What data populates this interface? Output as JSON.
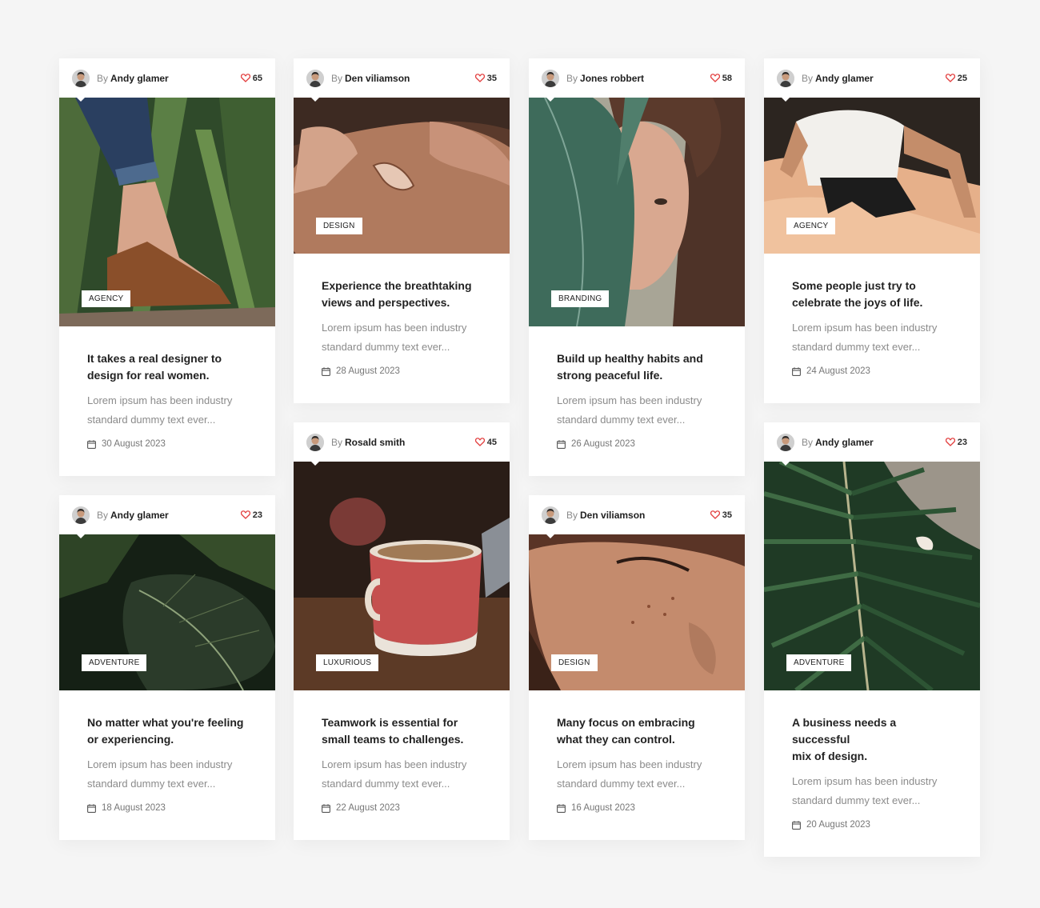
{
  "by_label": "By",
  "colors": {
    "accent_heart": "#e23d3d",
    "background": "#f5f5f5",
    "card": "#ffffff"
  },
  "posts": [
    {
      "author": "Andy glamer",
      "likes": "65",
      "tag": "AGENCY",
      "title_1": "It takes a real designer to",
      "title_2": "design for real women.",
      "excerpt_1": "Lorem ipsum has been industry",
      "excerpt_2": "standard dummy text ever...",
      "date": "30 August 2023",
      "image": "sandal-foot-in-grass"
    },
    {
      "author": "Andy glamer",
      "likes": "23",
      "tag": "ADVENTURE",
      "title_1": "No matter what you're feeling",
      "title_2": "or experiencing.",
      "excerpt_1": "Lorem ipsum has been industry",
      "excerpt_2": "standard dummy text ever...",
      "date": "18 August 2023",
      "image": "dark-green-leaf"
    },
    {
      "author": "Den viliamson",
      "likes": "35",
      "tag": "DESIGN",
      "title_1": "Experience the breathtaking",
      "title_2": "views and perspectives.",
      "excerpt_1": "Lorem ipsum has been industry",
      "excerpt_2": "standard dummy text ever...",
      "date": "28 August 2023",
      "image": "hands-on-clay"
    },
    {
      "author": "Rosald smith",
      "likes": "45",
      "tag": "LUXURIOUS",
      "title_1": "Teamwork is essential for",
      "title_2": "small teams to challenges.",
      "excerpt_1": "Lorem ipsum has been industry",
      "excerpt_2": "standard dummy text ever...",
      "date": "22 August 2023",
      "image": "red-coffee-cup"
    },
    {
      "author": "Jones robbert",
      "likes": "58",
      "tag": "BRANDING",
      "title_1": "Build up healthy habits and",
      "title_2": "strong peaceful life.",
      "excerpt_1": "Lorem ipsum has been industry",
      "excerpt_2": "standard dummy text ever...",
      "date": "26 August 2023",
      "image": "woman-behind-leaf"
    },
    {
      "author": "Den viliamson",
      "likes": "35",
      "tag": "DESIGN",
      "title_1": "Many focus on embracing",
      "title_2": "what they can control.",
      "excerpt_1": "Lorem ipsum has been industry",
      "excerpt_2": "standard dummy text ever...",
      "date": "16 August 2023",
      "image": "freckled-face-closeup"
    },
    {
      "author": "Andy glamer",
      "likes": "25",
      "tag": "AGENCY",
      "title_1": "Some people just try to",
      "title_2": "celebrate the joys of life.",
      "excerpt_1": "Lorem ipsum has been industry",
      "excerpt_2": "standard dummy text ever...",
      "date": "24 August 2023",
      "image": "man-on-sand-dune"
    },
    {
      "author": "Andy glamer",
      "likes": "23",
      "tag": "ADVENTURE",
      "title_1": "A business needs a successful",
      "title_2": "mix of design.",
      "excerpt_1": "Lorem ipsum has been industry",
      "excerpt_2": "standard dummy text ever...",
      "date": "20 August 2023",
      "image": "palm-frond"
    }
  ]
}
